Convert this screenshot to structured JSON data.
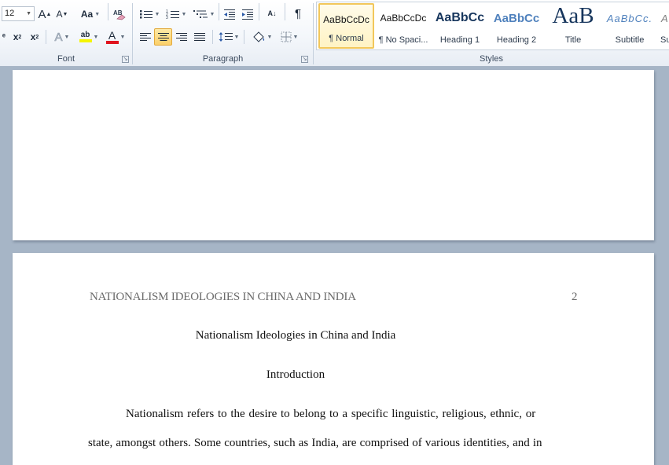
{
  "ribbon": {
    "font_group": {
      "label": "Font",
      "font_size": "12",
      "grow_font_glyph": "A",
      "shrink_font_glyph": "A",
      "change_case_glyph": "Aa",
      "subscript_glyph": "x",
      "subscript_mark": "2",
      "superscript_glyph": "x",
      "superscript_mark": "2",
      "text_effects_glyph": "A",
      "highlight_glyph": "ab",
      "font_color_glyph": "A",
      "highlight_color": "#f5f500",
      "font_color": "#e0141e"
    },
    "paragraph_group": {
      "label": "Paragraph",
      "sort_glyph": "A↓",
      "pilcrow_glyph": "¶"
    },
    "styles_group": {
      "label": "Styles",
      "tiles": [
        {
          "sample": "AaBbCcDc",
          "name": "¶ Normal"
        },
        {
          "sample": "AaBbCcDc",
          "name": "¶ No Spaci..."
        },
        {
          "sample": "AaBbCc",
          "name": "Heading 1"
        },
        {
          "sample": "AaBbCc",
          "name": "Heading 2"
        },
        {
          "sample": "AaB",
          "name": "Title"
        },
        {
          "sample": "AaBbCc.",
          "name": "Subtitle"
        },
        {
          "sample": "A",
          "name": "Su"
        }
      ]
    }
  },
  "document": {
    "page2": {
      "running_head": "NATIONALISM IDEOLOGIES IN CHINA AND INDIA",
      "page_number": "2",
      "title": "Nationalism Ideologies in China and India",
      "section_heading": "Introduction",
      "paragraph_line_1": "Nationalism refers to the desire to belong to a specific linguistic, religious, ethnic, or",
      "paragraph_line_2": "state, amongst others. Some countries, such as India, are comprised of various identities, and in"
    }
  },
  "colors": {
    "workspace": "#a6b5c6",
    "heading_blue": "#17365d",
    "selection_gold": "#f2c75b"
  }
}
